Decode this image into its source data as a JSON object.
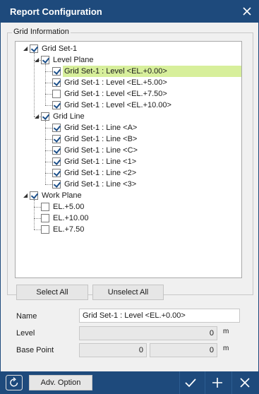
{
  "window": {
    "title": "Report Configuration"
  },
  "grid_information": {
    "legend": "Grid Information",
    "tree": [
      {
        "label": "Grid Set-1",
        "checked": true,
        "level": 0,
        "expanded": true
      },
      {
        "label": "Level Plane",
        "checked": true,
        "level": 1,
        "expanded": true
      },
      {
        "label": "Grid Set-1 : Level <EL.+0.00>",
        "checked": true,
        "level": 2,
        "selected": true
      },
      {
        "label": "Grid Set-1 : Level <EL.+5.00>",
        "checked": true,
        "level": 2
      },
      {
        "label": "Grid Set-1 : Level <EL.+7.50>",
        "checked": false,
        "level": 2
      },
      {
        "label": "Grid Set-1 : Level <EL.+10.00>",
        "checked": true,
        "level": 2
      },
      {
        "label": "Grid Line",
        "checked": true,
        "level": 1,
        "expanded": true
      },
      {
        "label": "Grid Set-1 : Line <A>",
        "checked": true,
        "level": 2
      },
      {
        "label": "Grid Set-1 : Line <B>",
        "checked": true,
        "level": 2
      },
      {
        "label": "Grid Set-1 : Line <C>",
        "checked": true,
        "level": 2
      },
      {
        "label": "Grid Set-1 : Line <1>",
        "checked": true,
        "level": 2
      },
      {
        "label": "Grid Set-1 : Line <2>",
        "checked": true,
        "level": 2
      },
      {
        "label": "Grid Set-1 : Line <3>",
        "checked": true,
        "level": 2
      },
      {
        "label": "Work Plane",
        "checked": true,
        "level": 0,
        "expanded": true
      },
      {
        "label": "EL.+5.00",
        "checked": false,
        "level": 1
      },
      {
        "label": "EL.+10.00",
        "checked": false,
        "level": 1
      },
      {
        "label": "EL.+7.50",
        "checked": false,
        "level": 1
      }
    ],
    "select_all": "Select All",
    "unselect_all": "Unselect All"
  },
  "properties": {
    "name_label": "Name",
    "name_value": "Grid Set-1 : Level <EL.+0.00>",
    "level_label": "Level",
    "level_value": "0",
    "level_unit": "m",
    "base_point_label": "Base Point",
    "base_point_x": "0",
    "base_point_y": "0",
    "base_point_unit": "m"
  },
  "footer": {
    "adv_option": "Adv. Option"
  },
  "colors": {
    "titlebar": "#1e4a7c",
    "selection": "#d7ef9b",
    "check": "#1b4f8a"
  }
}
